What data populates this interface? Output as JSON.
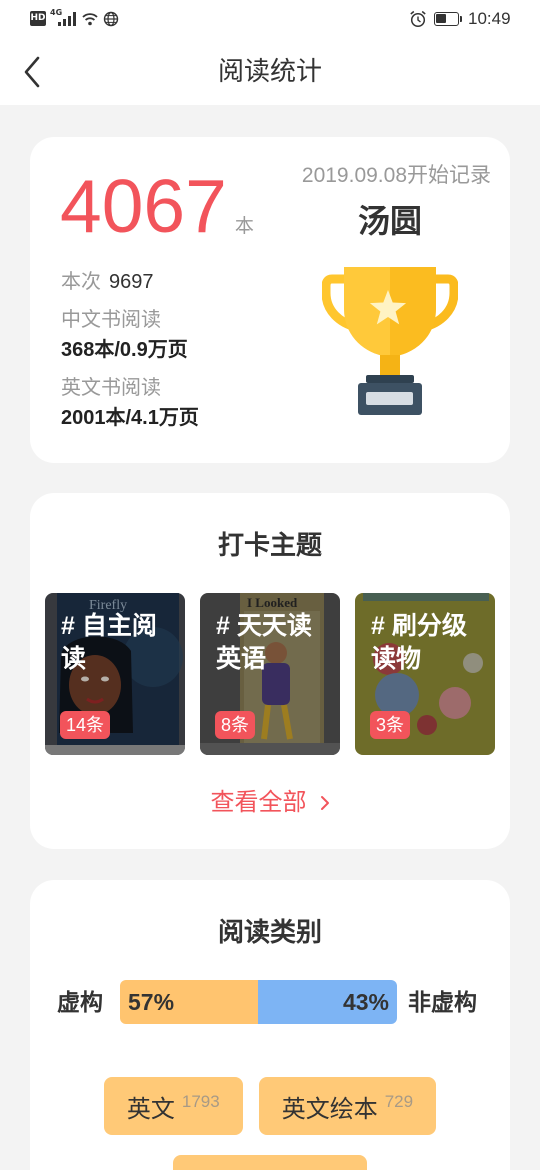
{
  "status_bar": {
    "hd": "HD",
    "network": "4G",
    "time": "10:49",
    "battery_level": 0.5
  },
  "header": {
    "title": "阅读统计"
  },
  "summary": {
    "total_count": "4067",
    "total_unit": "本",
    "start_note": "2019.09.08开始记录",
    "user_name": "汤圆",
    "this_time_label": "本次",
    "this_time_value": "9697",
    "chinese_label": "中文书阅读",
    "chinese_value": "368本/0.9万页",
    "english_label": "英文书阅读",
    "english_value": "2001本/4.1万页"
  },
  "topics": {
    "title": "打卡主题",
    "items": [
      {
        "label": "# 自主阅读",
        "count": "14条",
        "cover_text": "Firefly"
      },
      {
        "label": "# 天天读英语",
        "count": "8条",
        "cover_text": "I Looked"
      },
      {
        "label": "# 刷分级读物",
        "count": "3条"
      }
    ],
    "view_all": "查看全部"
  },
  "categories": {
    "title": "阅读类别",
    "fiction_label": "虚构",
    "fiction_percent": "57%",
    "nonfiction_label": "非虚构",
    "nonfiction_percent": "43%",
    "tags": [
      {
        "label": "英文",
        "count": "1793"
      },
      {
        "label": "英文绘本",
        "count": "729"
      }
    ]
  },
  "icons": {
    "back": "chevron-left-icon",
    "view_all": "chevron-right-icon",
    "trophy": "trophy-icon",
    "signal": "signal-icon",
    "wifi": "wifi-icon",
    "globe": "globe-icon",
    "alarm": "alarm-icon",
    "battery": "battery-icon"
  },
  "colors": {
    "accent_red": "#f2545b",
    "fiction_orange": "#ffc46f",
    "nonfiction_blue": "#7db4f4",
    "tag_orange": "#ffc977",
    "trophy_gold": "#ffc62e"
  }
}
